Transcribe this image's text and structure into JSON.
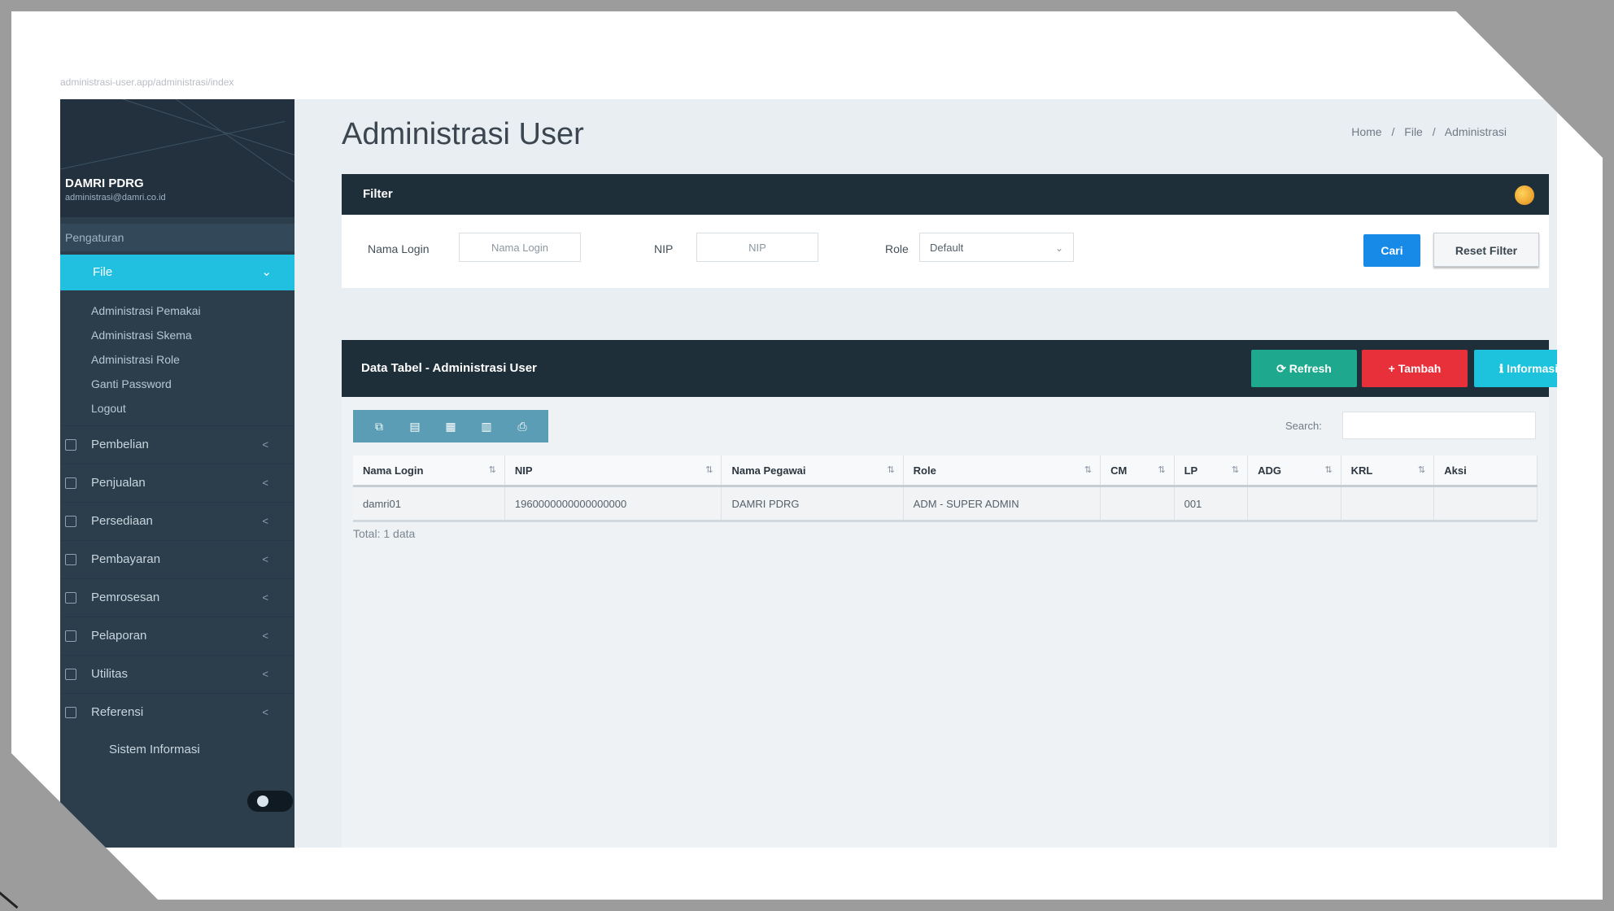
{
  "browser": {
    "url": "administrasi-user.app/administrasi/index"
  },
  "brand": {
    "name": "DAMRI PDRG",
    "subtitle": "administrasi@damri.co.id"
  },
  "sidebar": {
    "header": "Pengaturan",
    "active": {
      "label": "File",
      "chevron": "⌄"
    },
    "subitems": [
      {
        "label": "Administrasi Pemakai"
      },
      {
        "label": "Administrasi Skema"
      },
      {
        "label": "Administrasi Role"
      },
      {
        "label": "Ganti Password"
      },
      {
        "label": "Logout"
      }
    ],
    "items": [
      {
        "label": "Pembelian",
        "chevron": "<"
      },
      {
        "label": "Penjualan",
        "chevron": "<"
      },
      {
        "label": "Persediaan",
        "chevron": "<"
      },
      {
        "label": "Pembayaran",
        "chevron": "<"
      },
      {
        "label": "Pemrosesan",
        "chevron": "<"
      },
      {
        "label": "Pelaporan",
        "chevron": "<"
      },
      {
        "label": "Utilitas",
        "chevron": "<"
      },
      {
        "label": "Referensi",
        "chevron": "<"
      }
    ],
    "footer_item": "Sistem Informasi"
  },
  "page": {
    "title": "Administrasi User"
  },
  "breadcrumb": {
    "home": "Home",
    "section": "File",
    "current": "Administrasi",
    "sep": "/"
  },
  "filter": {
    "title": "Filter",
    "login_label": "Nama Login",
    "login_placeholder": "Nama Login",
    "nip_label": "NIP",
    "nip_placeholder": "NIP",
    "role_label": "Role",
    "role_value": "Default",
    "search_button": "Cari",
    "reset_button": "Reset Filter"
  },
  "data": {
    "title": "Data Tabel - Administrasi User",
    "btn_refresh": "⟳ Refresh",
    "btn_add": "+ Tambah",
    "btn_info": "ℹ Informasi",
    "search_label": "Search:",
    "columns": [
      "Nama Login",
      "NIP",
      "Nama Pegawai",
      "Role",
      "CM",
      "LP",
      "ADG",
      "KRL",
      "Aksi"
    ],
    "rows": [
      [
        "damri01",
        "1960000000000000000",
        "DAMRI PDRG",
        "ADM - SUPER ADMIN",
        "",
        "001",
        "",
        "",
        ""
      ]
    ],
    "total": "Total: 1 data"
  },
  "colors": {
    "sidebar": "#2c3e4c",
    "accent": "#21c0e0",
    "head": "#1f2f3a",
    "primary": "#1789e6",
    "danger": "#e8303a",
    "success": "#1ea98f"
  }
}
